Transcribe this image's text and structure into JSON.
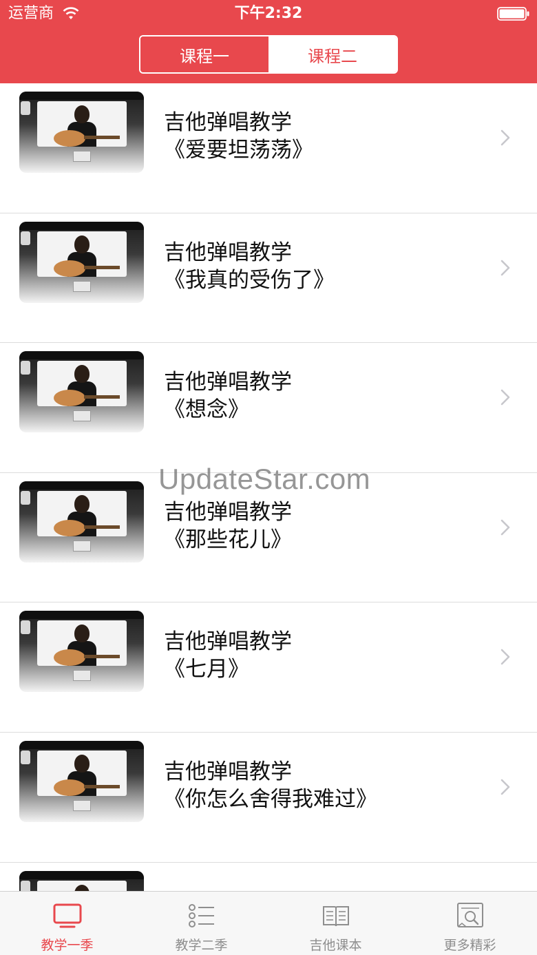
{
  "status_bar": {
    "carrier": "运营商",
    "time": "下午2:32",
    "icons": [
      "wifi-icon",
      "battery-icon"
    ]
  },
  "segment": {
    "options": [
      "课程一",
      "课程二"
    ],
    "selected": "课程二"
  },
  "lessons": [
    {
      "title": "吉他弹唱教学",
      "subtitle": "《爱要坦荡荡》"
    },
    {
      "title": "吉他弹唱教学",
      "subtitle": "《我真的受伤了》"
    },
    {
      "title": "吉他弹唱教学",
      "subtitle": "《想念》"
    },
    {
      "title": "吉他弹唱教学",
      "subtitle": "《那些花儿》"
    },
    {
      "title": "吉他弹唱教学",
      "subtitle": "《七月》"
    },
    {
      "title": "吉他弹唱教学",
      "subtitle": "《你怎么舍得我难过》"
    },
    {
      "title": "",
      "subtitle": ""
    }
  ],
  "watermark": "UpdateStar.com",
  "tabbar": {
    "tabs": [
      {
        "label": "教学一季",
        "icon": "monitor-icon",
        "active": true
      },
      {
        "label": "教学二季",
        "icon": "list-icon",
        "active": false
      },
      {
        "label": "吉他课本",
        "icon": "book-icon",
        "active": false
      },
      {
        "label": "更多精彩",
        "icon": "search-document-icon",
        "active": false
      }
    ]
  },
  "colors": {
    "accent": "#e8484d",
    "inactive_tab": "#8e8e8e",
    "separator": "#dcdcdc"
  }
}
